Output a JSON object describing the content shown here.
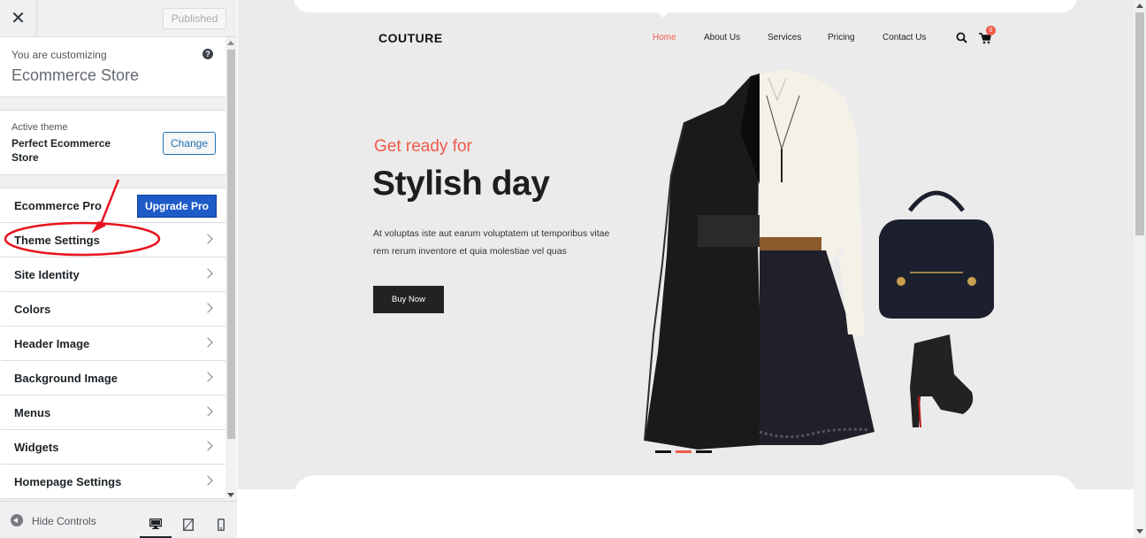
{
  "customizer": {
    "close_icon": "close-icon",
    "published_label": "Published",
    "customizing_pre": "You are customizing",
    "site_title": "Ecommerce Store",
    "help_icon": "help-icon",
    "active_theme_label": "Active theme",
    "theme_name": "Perfect Ecommerce Store",
    "change_label": "Change",
    "sections": [
      {
        "label": "Ecommerce Pro",
        "button": "Upgrade Pro"
      },
      {
        "label": "Theme Settings"
      },
      {
        "label": "Site Identity"
      },
      {
        "label": "Colors"
      },
      {
        "label": "Header Image"
      },
      {
        "label": "Background Image"
      },
      {
        "label": "Menus"
      },
      {
        "label": "Widgets"
      },
      {
        "label": "Homepage Settings"
      }
    ],
    "footer": {
      "hide_label": "Hide Controls",
      "devices": [
        "desktop-icon",
        "tablet-icon",
        "mobile-icon"
      ]
    },
    "annotation_color": "#e8141f"
  },
  "preview": {
    "logo": "COUTURE",
    "nav": [
      "Home",
      "About Us",
      "Services",
      "Pricing",
      "Contact Us"
    ],
    "active_nav": "Home",
    "cart_count": "0",
    "hero": {
      "kicker": "Get ready for",
      "title": "Stylish day",
      "description": "At voluptas iste aut earum voluptatem ut temporibus vitae rem rerum inventore et quia molestiae vel quas",
      "button": "Buy Now"
    },
    "accent_color": "#f05a4a",
    "slider_dots": 3,
    "active_slide": 2
  }
}
